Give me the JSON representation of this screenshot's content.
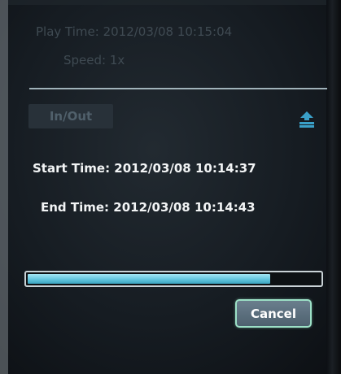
{
  "header": {
    "play_time": "Play Time: 2012/03/08 10:15:04",
    "speed": "Speed: 1x"
  },
  "toolbar": {
    "inout_label": "In/Out",
    "download_icon": "download-icon"
  },
  "range": {
    "start_time": "Start Time: 2012/03/08 10:14:37",
    "end_time": "End Time: 2012/03/08 10:14:43"
  },
  "progress": {
    "fraction": 0.83
  },
  "actions": {
    "cancel_label": "Cancel"
  },
  "colors": {
    "progress_fill": "#63c6de",
    "cancel_border": "#9ce0c6",
    "dim_text": "#3f4a52"
  }
}
